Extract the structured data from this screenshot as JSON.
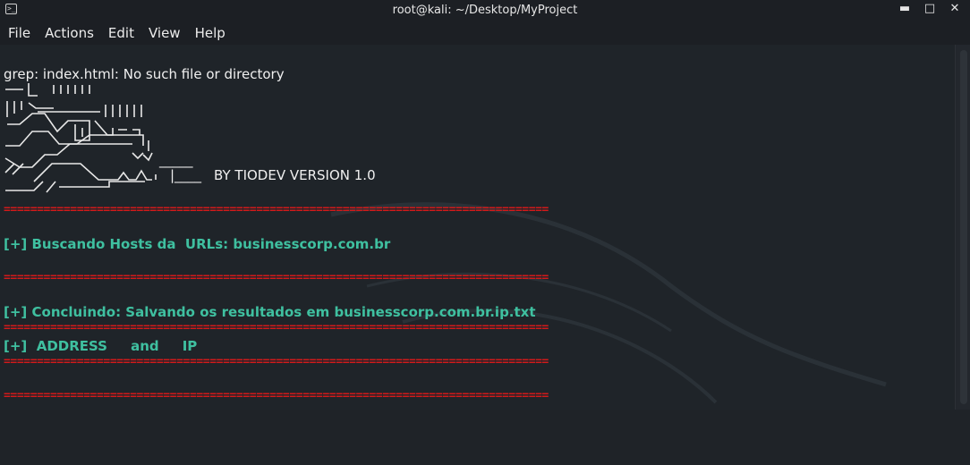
{
  "window": {
    "title": "root@kali: ~/Desktop/MyProject",
    "controls": [
      "minimize-icon",
      "maximize-icon",
      "close-icon"
    ]
  },
  "menu": [
    "File",
    "Actions",
    "Edit",
    "View",
    "Help"
  ],
  "terminal": {
    "grep_error": "grep: index.html: No such file or directory",
    "banner_underscores": "_____",
    "banner_pipe": "|____",
    "version": "BY TIODEV VERSION 1.0",
    "separator": "==================================================================================",
    "search_line": "[+] Buscando Hosts da  URLs: businesscorp.com.br",
    "conclude_line": "[+] Concluindo: Salvando os resultados em businesscorp.com.br.ip.txt",
    "address_line": "[+]  ADDRESS     and     IP"
  },
  "colors": {
    "background": "#1f2429",
    "separator": "#d11a1a",
    "info_text": "#3fc0a0"
  }
}
